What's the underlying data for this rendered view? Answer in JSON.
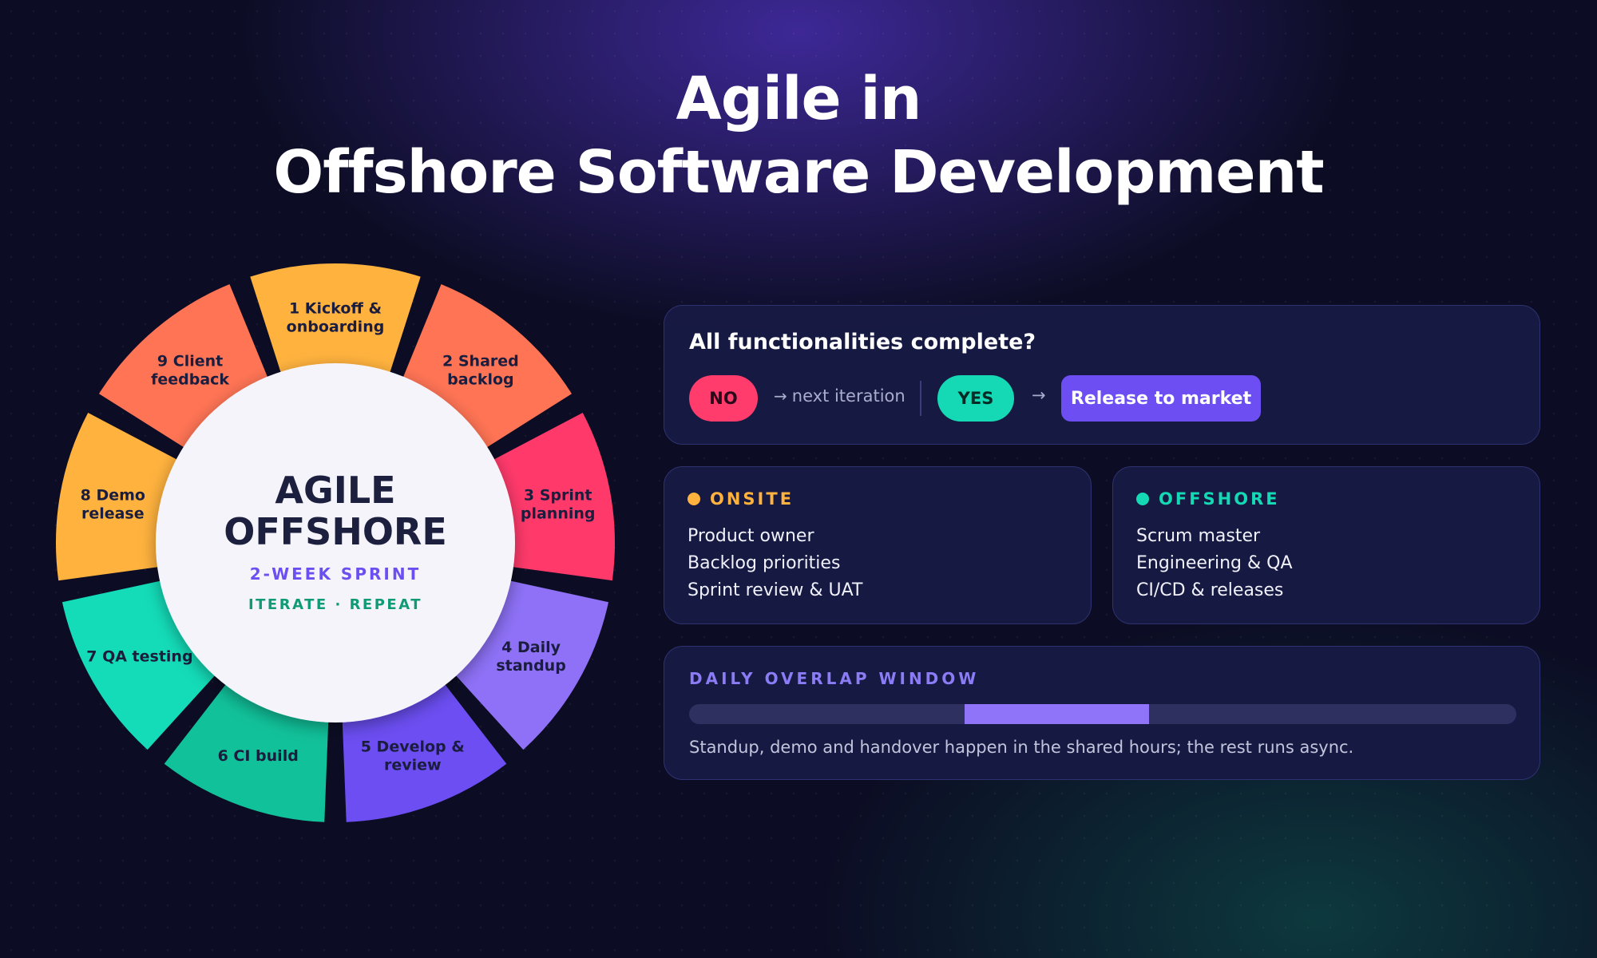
{
  "title": {
    "line1": "Agile in",
    "line2": "Offshore Software Development"
  },
  "wheel": {
    "hub": {
      "line1": "AGILE",
      "line2": "OFFSHORE",
      "sub1": "2-WEEK SPRINT",
      "sub2": "ITERATE · REPEAT"
    },
    "segments": [
      {
        "lines": [
          "1 Kickoff &",
          "onboarding"
        ],
        "color": "#ffb23e"
      },
      {
        "lines": [
          "2 Shared",
          "backlog"
        ],
        "color": "#ff7455"
      },
      {
        "lines": [
          "3 Sprint",
          "planning"
        ],
        "color": "#ff3a6b"
      },
      {
        "lines": [
          "4 Daily",
          "standup"
        ],
        "color": "#8e71f7"
      },
      {
        "lines": [
          "5 Develop &",
          "review"
        ],
        "color": "#6c4ef2"
      },
      {
        "lines": [
          "6 CI build"
        ],
        "color": "#11c19a"
      },
      {
        "lines": [
          "7 QA testing"
        ],
        "color": "#14dcb8"
      },
      {
        "lines": [
          "8 Demo",
          "release"
        ],
        "color": "#ffb23e"
      },
      {
        "lines": [
          "9 Client",
          "feedback"
        ],
        "color": "#ff7455"
      }
    ]
  },
  "decision": {
    "question": "All functionalities complete?",
    "no_label": "NO",
    "next_label": "next iteration",
    "yes_label": "YES",
    "release_label": "Release to market",
    "arrow_icon": "arrow-right-icon"
  },
  "onsite": {
    "heading": "ONSITE",
    "color": "#ffb23e",
    "items": [
      "Product owner",
      "Backlog priorities",
      "Sprint review & UAT"
    ]
  },
  "offshore": {
    "heading": "OFFSHORE",
    "color": "#14d9b4",
    "items": [
      "Scrum master",
      "Engineering & QA",
      "CI/CD & releases"
    ]
  },
  "overlap": {
    "heading": "DAILY OVERLAP WINDOW",
    "window_start": 0.333,
    "window_end": 0.556,
    "note": "Standup, demo and handover happen in the shared hours; the rest runs async."
  }
}
